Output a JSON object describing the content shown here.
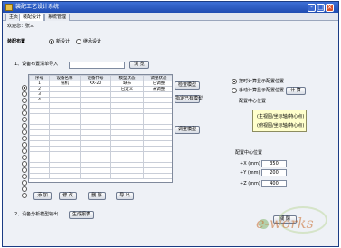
{
  "window": {
    "title": "装配工艺设计系统"
  },
  "tabs": [
    {
      "label": "主页"
    },
    {
      "label": "装配设计"
    },
    {
      "label": "系统管理"
    }
  ],
  "welcome": "欢迎您：张三",
  "section": {
    "label": "装配布置",
    "mode_options": [
      {
        "label": "新设计",
        "selected": true
      },
      {
        "label": "继承设计",
        "selected": false
      }
    ]
  },
  "import": {
    "label": "1、设备布置清单导入",
    "browse_label": "浏 览",
    "path_value": ""
  },
  "table": {
    "columns": [
      "序号",
      "设备名称",
      "设备代号",
      "模型状态",
      "调整状态"
    ],
    "rows": [
      [
        "1",
        "铣机",
        "XX-20",
        "缺布",
        "已调整"
      ],
      [
        "2",
        "",
        "",
        "已定义",
        "未调整"
      ],
      [
        "3",
        "",
        "",
        "",
        ""
      ],
      [
        "4",
        "",
        "",
        "",
        ""
      ]
    ],
    "selected_row": 0
  },
  "mid_buttons": [
    "检查模型",
    "指定已有模型",
    "调整模型"
  ],
  "bottom_buttons": [
    "添 加",
    "修 改",
    "删 除",
    "导 出"
  ],
  "right_panel": {
    "options": [
      {
        "label": "按时计算显示配置位置",
        "selected": true
      },
      {
        "label": "手动计算显示配置位置",
        "selected": false
      }
    ],
    "compute_label": "计 算",
    "location_title": "配置中心位置",
    "hint_lines": [
      "(主视图/坐标轴/特心点)",
      "(俯视图/坐标轴/特心点)"
    ],
    "center_title": "配置中心位置",
    "coords": [
      {
        "label": "+X (mm)",
        "value": "350"
      },
      {
        "label": "+Y (mm)",
        "value": "200"
      },
      {
        "label": "+Z (mm)",
        "value": "400"
      }
    ]
  },
  "export_section": {
    "label": "2、设备分析模型输出",
    "button": "生成报表"
  },
  "close_label": "關 閉",
  "logo": {
    "text": "e-works"
  }
}
